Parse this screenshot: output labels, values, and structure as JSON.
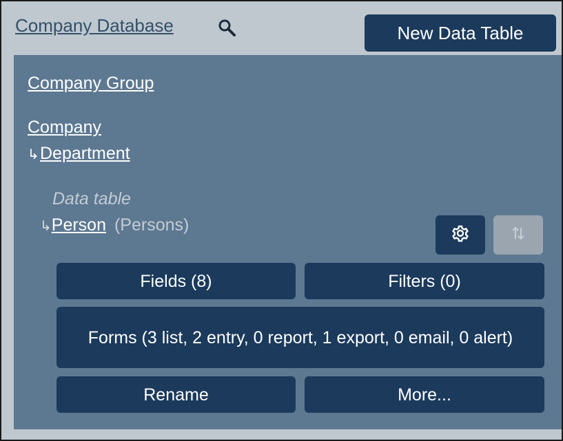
{
  "header": {
    "title": "Company Database",
    "search_icon": "search-icon",
    "new_table_label": "New Data Table"
  },
  "tree": {
    "company_group": "Company Group",
    "company": "Company",
    "department": "Department",
    "child_arrow": "↳",
    "data_table_caption": "Data table",
    "person": "Person",
    "person_plural": "(Persons)"
  },
  "icons": {
    "settings": "gear-icon",
    "sort": "sort-arrows-icon"
  },
  "buttons": {
    "fields": "Fields (8)",
    "filters": "Filters (0)",
    "forms": "Forms (3 list, 2 entry, 0 report, 1 export, 0 email, 0 alert)",
    "rename": "Rename",
    "more": "More..."
  },
  "colors": {
    "header_bg": "#bfc8cf",
    "panel_bg": "#5d7891",
    "button_bg": "#1b3a5c",
    "disabled_button_bg": "#9aa5b0",
    "title_link": "#34506a"
  }
}
